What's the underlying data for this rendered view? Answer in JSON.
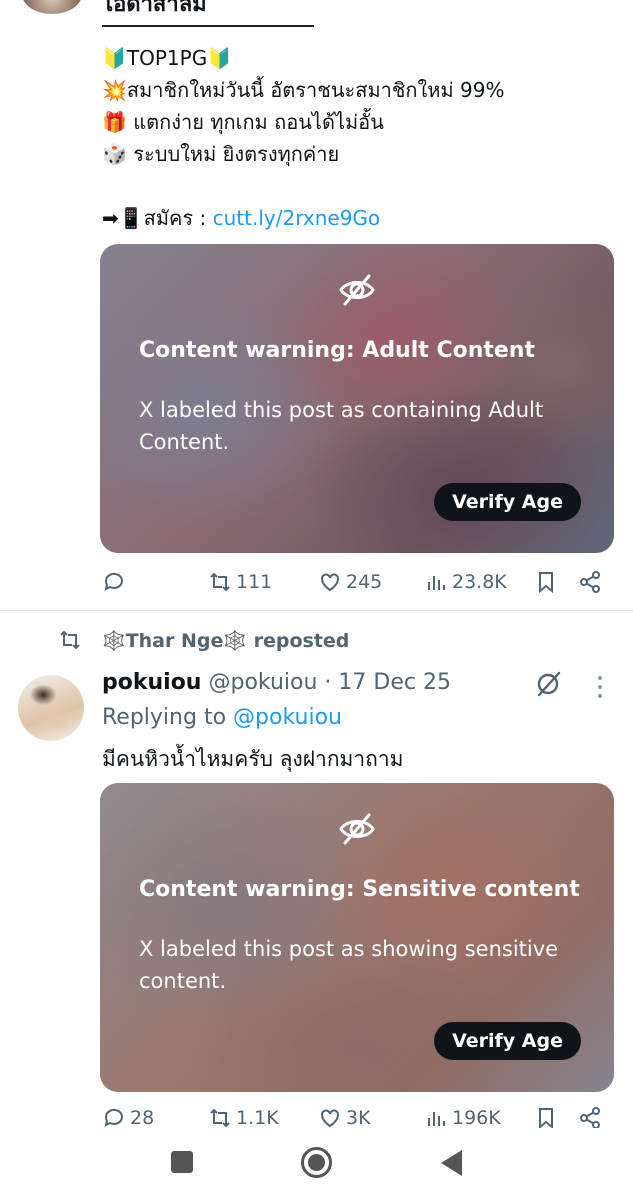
{
  "post1": {
    "author_cut": "ไอดำสาลี่ม",
    "lines": [
      "🔰TOP1PG🔰",
      "💥สมาชิกใหม่วันนี้ อัตราชนะสมาชิกใหม่ 99%",
      "🎁 แตกง่าย ทุกเกม ถอนได้ไม่อั้น",
      "🎲 ระบบใหม่ ยิงตรงทุกค่าย"
    ],
    "signup_prefix": "➡📱สมัคร : ",
    "signup_link": "cutt.ly/2rxne9Go",
    "media": {
      "icon": "eye-slash-icon",
      "warning_title": "Content warning: Adult Content",
      "warning_body": "X labeled this post as containing Adult Content.",
      "button": "Verify Age"
    },
    "actions": {
      "replies": "",
      "reposts": "111",
      "likes": "245",
      "views": "23.8K"
    }
  },
  "repost_banner": "🕸️Thar Nge🕸️ reposted",
  "post2": {
    "display_name": "pokuiou",
    "meta": " @pokuiou · 17 Dec 25",
    "replying_label": "Replying to ",
    "replying_handle": "@pokuiou",
    "text": "มีคนหิวน้ำไหมครับ ลุงฝากมาถาม",
    "media": {
      "icon": "eye-slash-icon",
      "warning_title": "Content warning: Sensitive content",
      "warning_body": "X labeled this post as showing sensitive content.",
      "button": "Verify Age"
    },
    "actions": {
      "replies": "28",
      "reposts": "1.1K",
      "likes": "3K",
      "views": "196K"
    }
  },
  "colors": {
    "link": "#1d9bf0",
    "text": "#0f1419",
    "muted": "#536471",
    "button_bg": "#0f1419"
  }
}
